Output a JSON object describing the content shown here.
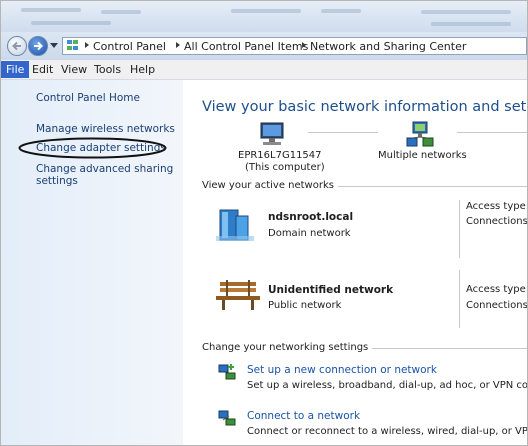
{
  "breadcrumb": [
    "Control Panel",
    "All Control Panel Items",
    "Network and Sharing Center"
  ],
  "menu": [
    "File",
    "Edit",
    "View",
    "Tools",
    "Help"
  ],
  "sidebar": {
    "home": "Control Panel Home",
    "links": [
      "Manage wireless networks",
      "Change adapter settings",
      "Change advanced sharing",
      "settings"
    ]
  },
  "main": {
    "title": "View your basic network information and set up connec",
    "map": {
      "computer_name": "EPR16L7G11547",
      "computer_sub": "(This computer)",
      "networks": "Multiple networks"
    },
    "active_section": "View your active networks",
    "networks": [
      {
        "name": "ndsnroot.local",
        "type": "Domain network",
        "access": "Access type:",
        "connections": "Connections:"
      },
      {
        "name": "Unidentified network",
        "type": "Public network",
        "access": "Access type:",
        "connections": "Connections:"
      }
    ],
    "settings_section": "Change your networking settings",
    "tasks": [
      {
        "title": "Set up a new connection or network",
        "desc": "Set up a wireless, broadband, dial-up, ad hoc, or VPN connectio"
      },
      {
        "title": "Connect to a network",
        "desc": "Connect or reconnect to a wireless, wired, dial-up, or VPN netw"
      }
    ]
  },
  "colors": {
    "accent": "#3366cc",
    "link": "#1a53a6",
    "title": "#1e4f8c",
    "sidebar_link": "#1a3f73"
  }
}
